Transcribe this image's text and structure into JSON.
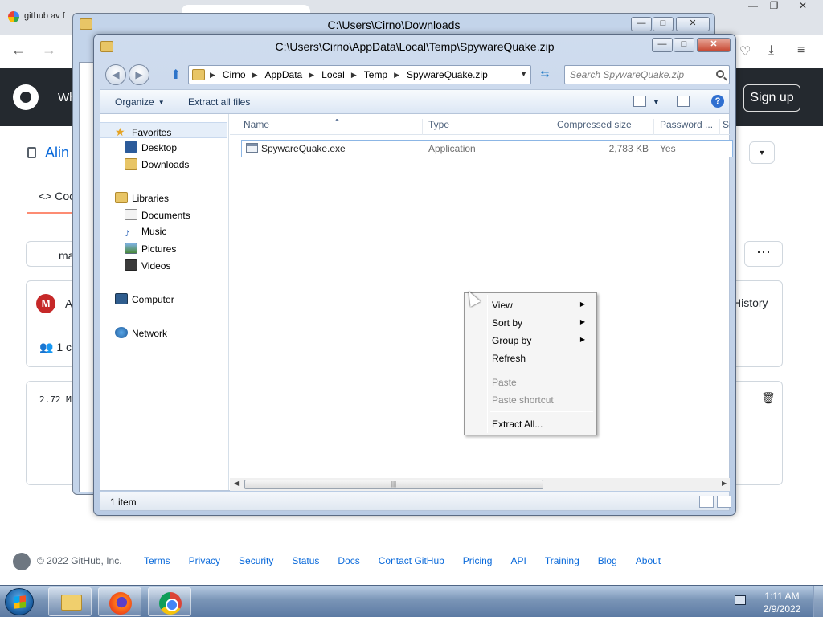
{
  "browser": {
    "tab_title": "github av f",
    "header_partial": "Wh",
    "sign_up": "Sign up",
    "repo_partial": "Alin",
    "code_tab_partial": "Coc",
    "branch_partial": "ma",
    "commit_avatar_partial": "A",
    "contributors_partial": "1 co",
    "file_size_partial": "2.72 M",
    "history": "History",
    "page_partial": "1",
    "footer_copyright": "© 2022 GitHub, Inc.",
    "footer_links": [
      "Terms",
      "Privacy",
      "Security",
      "Status",
      "Docs",
      "Contact GitHub",
      "Pricing",
      "API",
      "Training",
      "Blog",
      "About"
    ]
  },
  "back_window": {
    "title": "C:\\Users\\Cirno\\Downloads"
  },
  "window": {
    "title": "C:\\Users\\Cirno\\AppData\\Local\\Temp\\SpywareQuake.zip",
    "breadcrumbs": [
      "Cirno",
      "AppData",
      "Local",
      "Temp",
      "SpywareQuake.zip"
    ],
    "search_placeholder": "Search SpywareQuake.zip",
    "toolbar": {
      "organize": "Organize",
      "extract_all": "Extract all files"
    },
    "nav": {
      "favorites": "Favorites",
      "desktop": "Desktop",
      "downloads": "Downloads",
      "libraries": "Libraries",
      "documents": "Documents",
      "music": "Music",
      "pictures": "Pictures",
      "videos": "Videos",
      "computer": "Computer",
      "network": "Network"
    },
    "columns": [
      "Name",
      "Type",
      "Compressed size",
      "Password ...",
      "Si"
    ],
    "files": [
      {
        "name": "SpywareQuake.exe",
        "type": "Application",
        "compressed_size": "2,783 KB",
        "password": "Yes"
      }
    ],
    "status": "1 item"
  },
  "context_menu": {
    "items": [
      {
        "label": "View",
        "submenu": true,
        "enabled": true
      },
      {
        "label": "Sort by",
        "submenu": true,
        "enabled": true
      },
      {
        "label": "Group by",
        "submenu": true,
        "enabled": true
      },
      {
        "label": "Refresh",
        "submenu": false,
        "enabled": true
      },
      {
        "label": "Paste",
        "submenu": false,
        "enabled": false
      },
      {
        "label": "Paste shortcut",
        "submenu": false,
        "enabled": false
      },
      {
        "label": "Extract All...",
        "submenu": false,
        "enabled": true
      }
    ]
  },
  "taskbar": {
    "apps": [
      "file-explorer-icon",
      "firefox-icon",
      "chrome-icon"
    ],
    "time": "1:11 AM",
    "date": "2/9/2022"
  },
  "icons": {
    "submenu_arrow": "▶",
    "dropdown_caret": "▼",
    "favorite_star": "★"
  },
  "colors": {
    "accent": "#0969da",
    "window_frame": "#b9cbe4",
    "github_header": "#24292f"
  }
}
